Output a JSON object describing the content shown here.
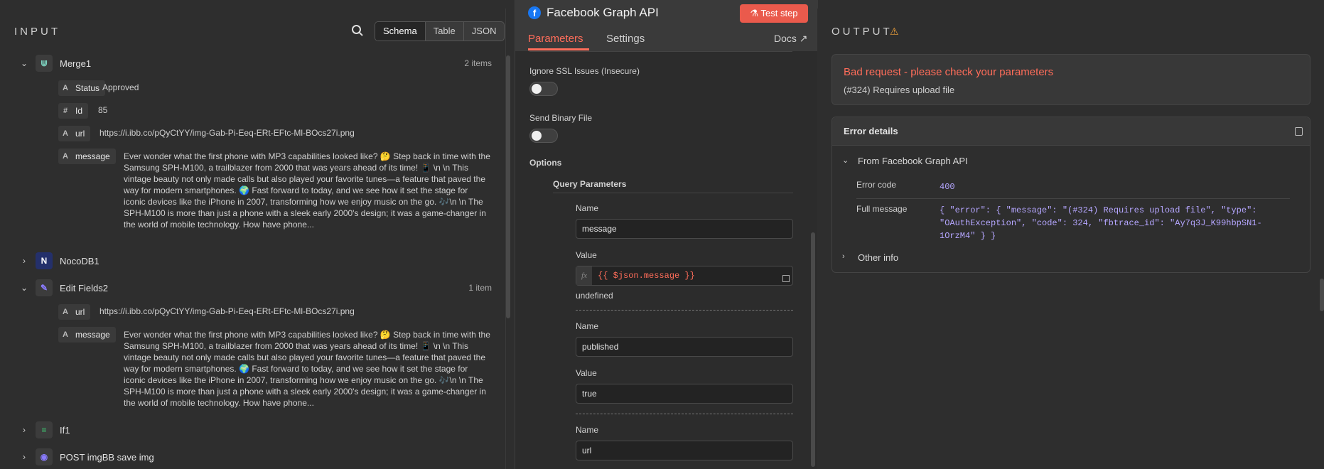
{
  "input": {
    "title": "INPUT",
    "view_tabs": [
      "Schema",
      "Table",
      "JSON"
    ],
    "nodes": [
      {
        "name": "Merge1",
        "count": "2 items",
        "icon_color": "#7dd3c0"
      },
      {
        "name": "NocoDB1",
        "count": "",
        "icon_color": "#3b4cff"
      },
      {
        "name": "Edit Fields2",
        "count": "1 item",
        "icon_color": "#8a7bff"
      },
      {
        "name": "If1",
        "count": "",
        "icon_color": "#3fbf6f"
      },
      {
        "name": "POST imgBB save img",
        "count": "",
        "icon_color": "#8a7bff"
      }
    ],
    "merge_fields": {
      "status_key": "Status",
      "status_val": "Approved",
      "id_key": "Id",
      "id_val": "85",
      "url_key": "url",
      "url_val": "https://i.ibb.co/pQyCtYY/img-Gab-Pi-Eeq-ERt-EFtc-Ml-BOcs27i.png",
      "message_key": "message",
      "message_val": "Ever wonder what the first phone with MP3 capabilities looked like? 🤔 Step back in time with the Samsung SPH-M100, a trailblazer from 2000 that was years ahead of its time! 📱 \\n \\n This vintage beauty not only made calls but also played your favorite tunes—a feature that paved the way for modern smartphones. 🌍 Fast forward to today, and we see how it set the stage for iconic devices like the iPhone in 2007, transforming how we enjoy music on the go. 🎶\\n \\n The SPH-M100 is more than just a phone with a sleek early 2000's design; it was a game-changer in the world of mobile technology. How have phone..."
    },
    "edit_fields": {
      "url_key": "url",
      "url_val": "https://i.ibb.co/pQyCtYY/img-Gab-Pi-Eeq-ERt-EFtc-Ml-BOcs27i.png",
      "message_key": "message",
      "message_val": "Ever wonder what the first phone with MP3 capabilities looked like? 🤔 Step back in time with the Samsung SPH-M100, a trailblazer from 2000 that was years ahead of its time! 📱 \\n \\n This vintage beauty not only made calls but also played your favorite tunes—a feature that paved the way for modern smartphones. 🌍 Fast forward to today, and we see how it set the stage for iconic devices like the iPhone in 2007, transforming how we enjoy music on the go. 🎶\\n \\n The SPH-M100 is more than just a phone with a sleek early 2000's design; it was a game-changer in the world of mobile technology. How have phone..."
    }
  },
  "node": {
    "title": "Facebook Graph API",
    "test_step": "Test step",
    "tabs": [
      "Parameters",
      "Settings"
    ],
    "docs": "Docs",
    "ignore_ssl_label": "Ignore SSL Issues (Insecure)",
    "send_binary_label": "Send Binary File",
    "options_label": "Options",
    "query_params_label": "Query Parameters",
    "name_label": "Name",
    "value_label": "Value",
    "param1_name": "message",
    "param1_value": "{{ $json.message }}",
    "param1_preview": "undefined",
    "param2_name": "published",
    "param2_value": "true",
    "param3_name": "url"
  },
  "output": {
    "title": "OUTPUT",
    "error_title": "Bad request - please check your parameters",
    "error_sub": "(#324) Requires upload file",
    "details_title": "Error details",
    "from_label": "From Facebook Graph API",
    "error_code_key": "Error code",
    "error_code_val": "400",
    "full_message_key": "Full message",
    "full_message_val": "{ \"error\": { \"message\": \"(#324) Requires upload file\", \"type\": \"OAuthException\", \"code\": 324, \"fbtrace_id\": \"Ay7q3J_K99hbpSN1-1OrzM4\" } }",
    "other_info": "Other info"
  }
}
